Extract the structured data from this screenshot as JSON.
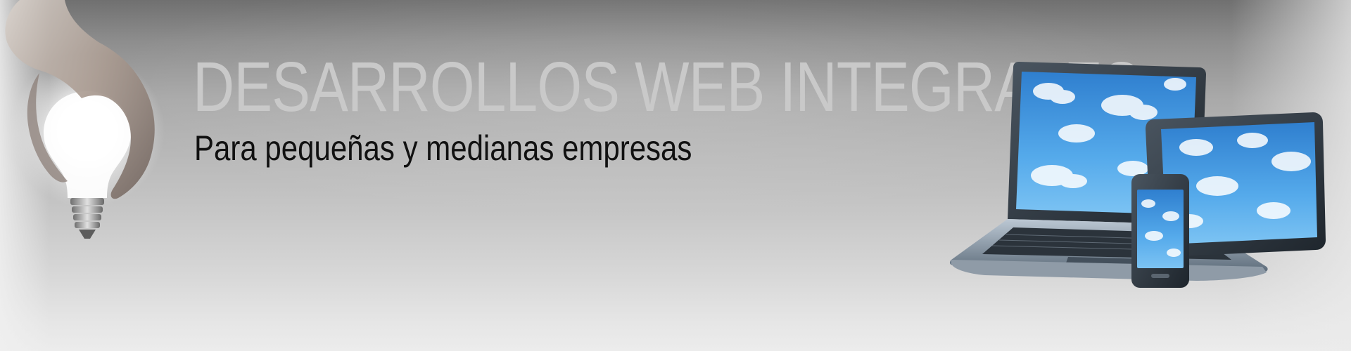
{
  "banner": {
    "headline": "DESARROLLOS WEB INTEGRALES",
    "subheadline": "Para pequeñas y medianas empresas"
  },
  "colors": {
    "headline": "#c9c9c9",
    "subheadline": "#111111",
    "background_top": "#707070",
    "background_bottom": "#ececec",
    "screen_sky": "#3f9ae0"
  },
  "illustrations": {
    "left": "hand-holding-glowing-lightbulb",
    "right": "laptop-tablet-smartphone-with-cloud-screens"
  }
}
